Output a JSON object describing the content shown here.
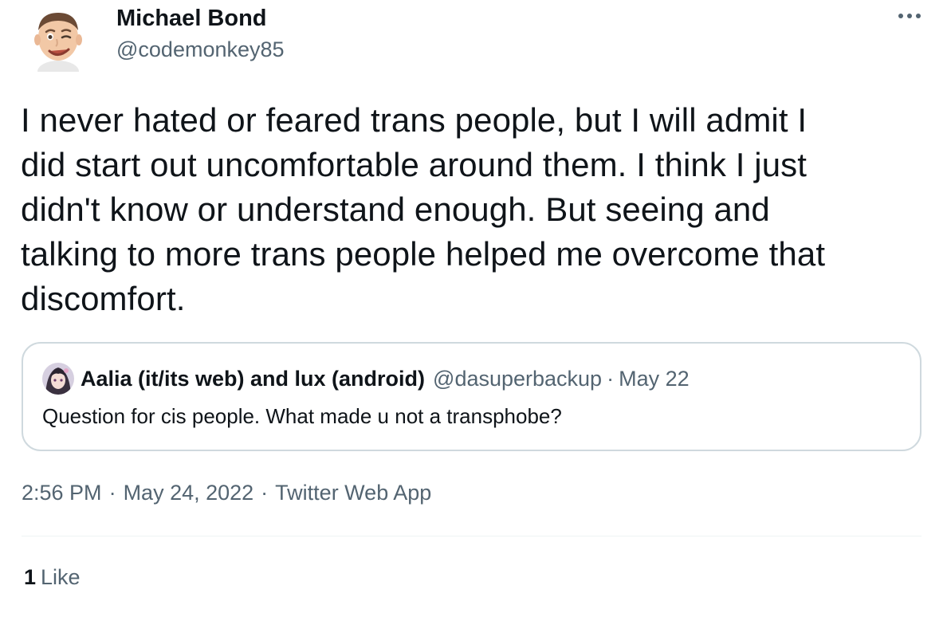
{
  "tweet": {
    "author": {
      "name": "Michael Bond",
      "handle": "@codemonkey85",
      "avatar_icon": "memoji-avatar"
    },
    "more_icon": "more-options-icon",
    "text": "I never hated or feared trans people, but I will admit I\ndid start out uncomfortable around them. I think I just\ndidn't know or understand enough. But seeing and\ntalking to more trans people helped me overcome that\ndiscomfort.",
    "quoted_tweet": {
      "avatar_icon": "anime-avatar",
      "name": "Aalia (it/its web) and lux (android)",
      "handle": "@dasuperbackup",
      "separator": "·",
      "date": "May 22",
      "text": "Question for cis people. What made u not a transphobe?"
    },
    "meta": {
      "time": "2:56 PM",
      "separator": "·",
      "date": "May 24, 2022",
      "source": "Twitter Web App"
    },
    "stats": {
      "likes_count": "1",
      "likes_label": "Like"
    }
  },
  "colors": {
    "text_primary": "#0f1419",
    "text_secondary": "#536471",
    "border": "#cfd9de",
    "divider": "#eff3f4",
    "background": "#ffffff"
  }
}
